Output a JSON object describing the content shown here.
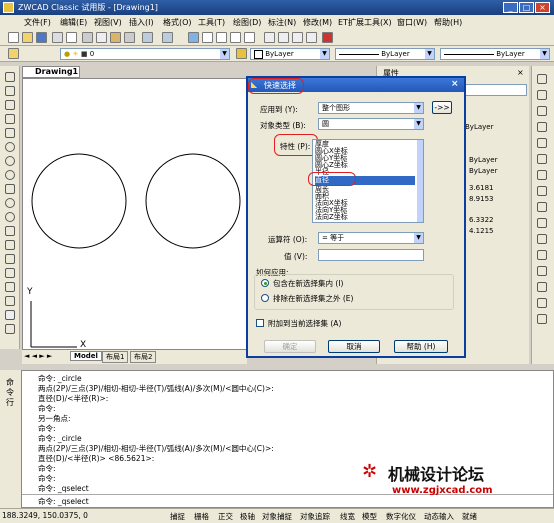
{
  "window": {
    "title": "ZWCAD Classic 试用版 - [Drawing1]"
  },
  "menu": [
    "文件(F)",
    "编辑(E)",
    "视图(V)",
    "插入(I)",
    "格式(O)",
    "工具(T)",
    "绘图(D)",
    "标注(N)",
    "修改(M)",
    "ET扩展工具(X)",
    "窗口(W)",
    "帮助(H)"
  ],
  "toolbar": {
    "layer_value": "0",
    "color_value": "ByLayer",
    "linetype_value": "ByLayer",
    "lineweight_value": "ByLayer"
  },
  "drawing": {
    "tab_label": "Drawing1",
    "ucs_x": "X",
    "ucs_y": "Y",
    "layout_tabs": [
      "Model",
      "布局1",
      "布局2"
    ]
  },
  "properties": {
    "header": "属性",
    "values": [
      "ByLayer",
      "ByLayer",
      "3.6181",
      "8.9153",
      "6.3322",
      "4.1215"
    ]
  },
  "dialog": {
    "title": "快速选择",
    "apply_to_label": "应用到 (Y):",
    "apply_to_value": "整个图形",
    "object_type_label": "对象类型 (B):",
    "object_type_value": "圆",
    "properties_label": "特性 (P):",
    "properties_list": [
      "厚度",
      "圆心X坐标",
      "圆心Y坐标",
      "圆心Z坐标",
      "半径",
      "直径",
      "周长",
      "面积",
      "法向X坐标",
      "法向Y坐标",
      "法向Z坐标"
    ],
    "selected_property": "直径",
    "operator_label": "运算符 (O):",
    "operator_value": "= 等于",
    "value_label": "值 (V):",
    "value_value": "",
    "how_apply_label": "如何应用:",
    "radio_include": "包含在新选择集内 (I)",
    "radio_exclude": "排除在新选择集之外 (E)",
    "append_label": "附加到当前选择集 (A)",
    "ok_label": "确定",
    "cancel_label": "取消",
    "help_label": "帮助 (H)"
  },
  "command": {
    "label": "命令行",
    "lines": [
      "命令: _circle",
      "两点(2P)/三点(3P)/相切-相切-半径(T)/弧线(A)/多次(M)/<圆中心(C)>:",
      "直径(D)/<半径(R)>:",
      "命令:",
      "另一角点:",
      "命令:",
      "命令: _circle",
      "两点(2P)/三点(3P)/相切-相切-半径(T)/弧线(A)/多次(M)/<圆中心(C)>:",
      "直径(D)/<半径(R)> <86.5621>:",
      "命令:",
      "命令:",
      "命令: _qselect"
    ],
    "prompt": "命令: _qselect"
  },
  "watermark": {
    "text": "机械设计论坛",
    "url": "www.zgjxcad.com"
  },
  "status": {
    "coords": "188.3249, 150.0375, 0",
    "buttons": [
      "捕捉",
      "栅格",
      "正交",
      "极轴",
      "对象捕捉",
      "对象追踪",
      "线宽",
      "模型",
      "数字化仪",
      "动态输入",
      "就绪"
    ]
  }
}
